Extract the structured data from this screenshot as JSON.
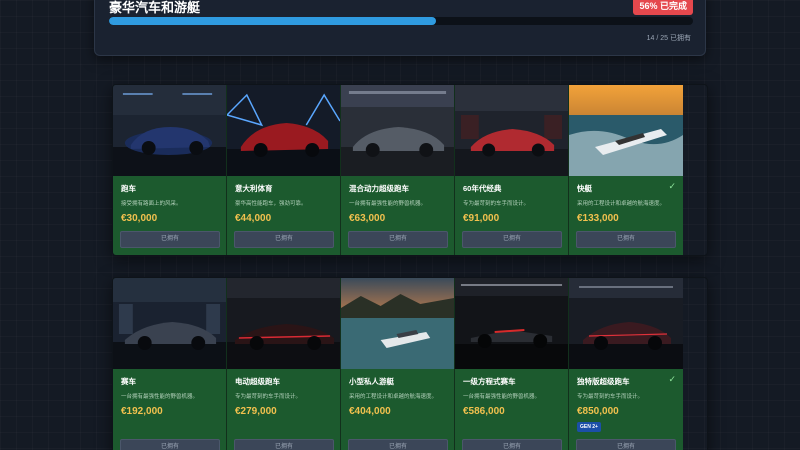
{
  "header": {
    "title": "豪华汽车和游艇",
    "badge": "56% 已完成",
    "progress_fraction": 0.56,
    "count": "14 / 25 已拥有"
  },
  "row1": [
    {
      "name": "跑车",
      "desc": "接受拥有路面上的风采。",
      "price": "€30,000",
      "button": "已拥有",
      "owned_check": false
    },
    {
      "name": "意大利体育",
      "desc": "豪华高性能跑车，强劲可靠。",
      "price": "€44,000",
      "button": "已拥有",
      "owned_check": false
    },
    {
      "name": "混合动力超级跑车",
      "desc": "一台拥有最强性能的野兽机器。",
      "price": "€63,000",
      "button": "已拥有",
      "owned_check": false
    },
    {
      "name": "60年代经典",
      "desc": "专为最苛刻的车手而设计。",
      "price": "€91,000",
      "button": "已拥有",
      "owned_check": false
    },
    {
      "name": "快艇",
      "desc": "采用的工程设计和卓越的航海速度。",
      "price": "€133,000",
      "button": "已拥有",
      "owned_check": true
    }
  ],
  "row2": [
    {
      "name": "赛车",
      "desc": "一台拥有最强性能的野兽机器。",
      "price": "€192,000",
      "button": "已拥有",
      "owned_check": false
    },
    {
      "name": "电动超级跑车",
      "desc": "专为最苛刻的车手而设计。",
      "price": "€279,000",
      "button": "已拥有",
      "owned_check": false
    },
    {
      "name": "小型私人游艇",
      "desc": "采用的工程设计和卓越的航海速度。",
      "price": "€404,000",
      "button": "已拥有",
      "owned_check": false
    },
    {
      "name": "一级方程式赛车",
      "desc": "一台拥有最强性能的野兽机器。",
      "price": "€586,000",
      "button": "已拥有",
      "owned_check": false
    },
    {
      "name": "独特版超级跑车",
      "desc": "专为最苛刻的车手而设计。",
      "price": "€850,000",
      "button": "已拥有",
      "owned_check": true,
      "badge": "GEN 2+"
    }
  ],
  "colors": {
    "card_bg": "#1c5a2e",
    "price": "#f2c14e",
    "progress": "#2f9be0",
    "badge_red": "#e5484d"
  }
}
